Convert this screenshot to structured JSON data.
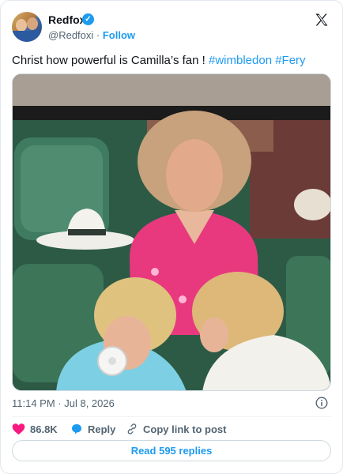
{
  "author": {
    "name": "Redfoxi",
    "handle": "@Redfoxi",
    "separator": " · ",
    "follow_label": "Follow"
  },
  "tweet": {
    "text": "Christ how powerful is Camilla’s fan ! ",
    "hashtags": [
      "#wimbledon",
      "#Fery"
    ],
    "timestamp": "11:14 PM · Jul 8, 2026"
  },
  "actions": {
    "likes": "86.8K",
    "reply_label": "Reply",
    "copy_label": "Copy link to post",
    "read_replies_label": "Read 595 replies"
  },
  "icons": [
    "x-logo-icon",
    "verified-badge-icon",
    "heart-icon",
    "reply-bubble-icon",
    "link-icon",
    "info-icon"
  ],
  "colors": {
    "accent": "#1d9bf0",
    "like": "#f91880",
    "text": "#0f1419",
    "secondary": "#536471"
  }
}
